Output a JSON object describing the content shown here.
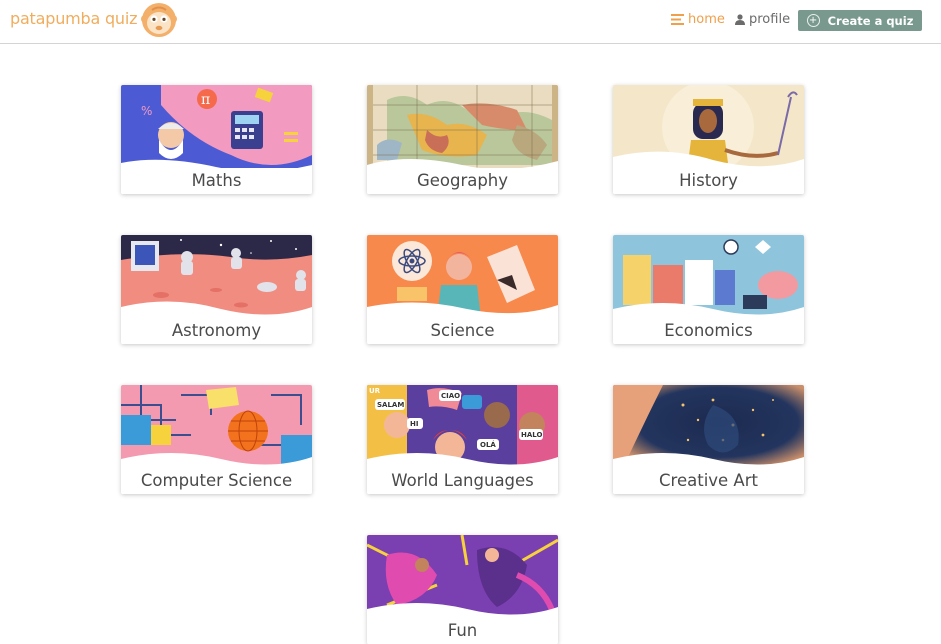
{
  "header": {
    "brand": "patapumba quiz",
    "logo_icon": "monkey-face-icon",
    "nav_home": "home",
    "nav_profile": "profile",
    "create_quiz": "Create a quiz",
    "accent_color": "#f0a04b",
    "button_color": "#79998e"
  },
  "categories": [
    {
      "label": "Maths"
    },
    {
      "label": "Geography"
    },
    {
      "label": "History"
    },
    {
      "label": "Astronomy"
    },
    {
      "label": "Science"
    },
    {
      "label": "Economics"
    },
    {
      "label": "Computer Science"
    },
    {
      "label": "World Languages"
    },
    {
      "label": "Creative Art"
    },
    {
      "label": "Fun"
    }
  ],
  "card_text": {
    "geography_words": "",
    "languages_words": [
      "SALAM",
      "HI",
      "CIAO",
      "OLÁ",
      "HALO",
      "UR"
    ]
  }
}
